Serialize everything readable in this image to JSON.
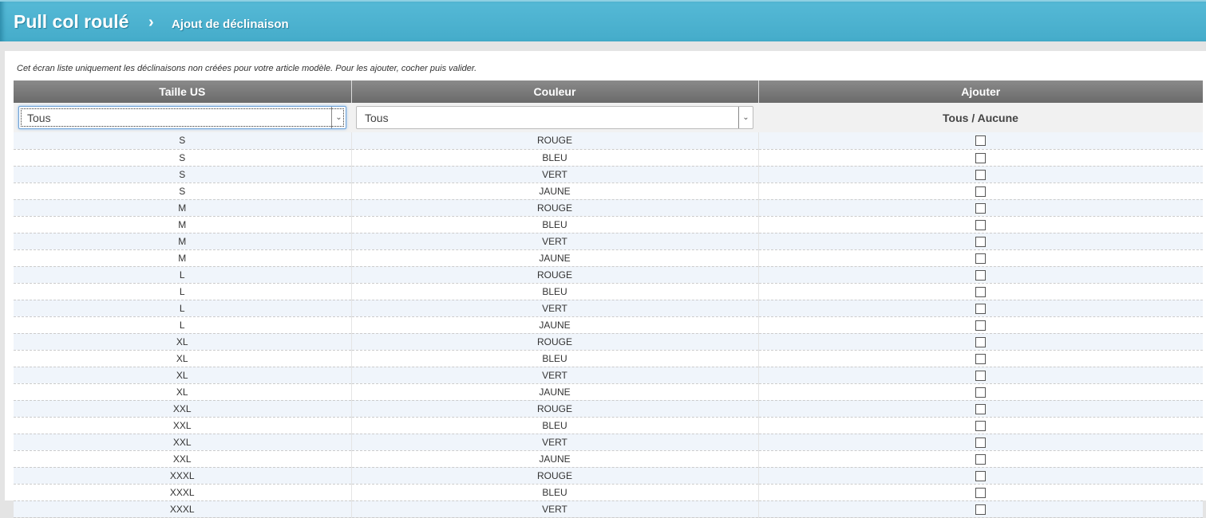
{
  "header": {
    "title": "Pull col roulé",
    "separator": "›",
    "subtitle": "Ajout de déclinaison"
  },
  "info": "Cet écran liste uniquement les déclinaisons non créées pour votre article modèle. Pour les ajouter, cocher puis valider.",
  "columns": [
    "Taille US",
    "Couleur",
    "Ajouter"
  ],
  "filters": {
    "taille": "Tous",
    "couleur": "Tous",
    "select_all": "Tous / Aucune"
  },
  "rows": [
    [
      "S",
      "ROUGE"
    ],
    [
      "S",
      "BLEU"
    ],
    [
      "S",
      "VERT"
    ],
    [
      "S",
      "JAUNE"
    ],
    [
      "M",
      "ROUGE"
    ],
    [
      "M",
      "BLEU"
    ],
    [
      "M",
      "VERT"
    ],
    [
      "M",
      "JAUNE"
    ],
    [
      "L",
      "ROUGE"
    ],
    [
      "L",
      "BLEU"
    ],
    [
      "L",
      "VERT"
    ],
    [
      "L",
      "JAUNE"
    ],
    [
      "XL",
      "ROUGE"
    ],
    [
      "XL",
      "BLEU"
    ],
    [
      "XL",
      "VERT"
    ],
    [
      "XL",
      "JAUNE"
    ],
    [
      "XXL",
      "ROUGE"
    ],
    [
      "XXL",
      "BLEU"
    ],
    [
      "XXL",
      "VERT"
    ],
    [
      "XXL",
      "JAUNE"
    ],
    [
      "XXXL",
      "ROUGE"
    ],
    [
      "XXXL",
      "BLEU"
    ],
    [
      "XXXL",
      "VERT"
    ]
  ]
}
